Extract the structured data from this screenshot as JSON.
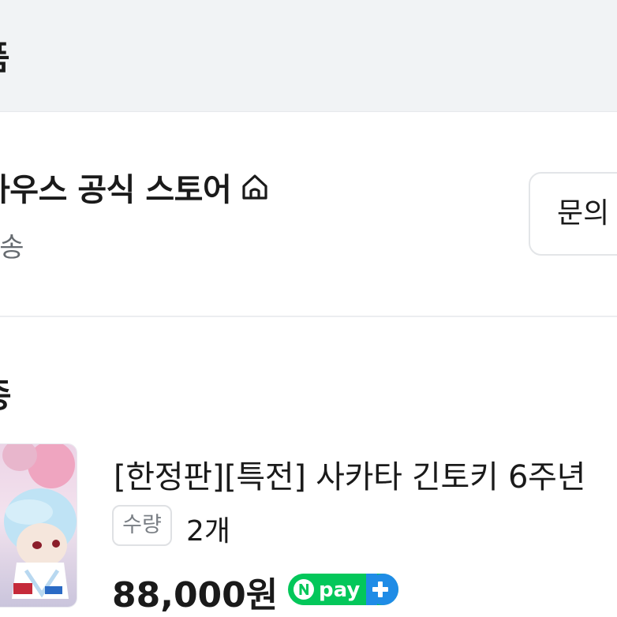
{
  "header": {
    "section_title": "품"
  },
  "store": {
    "name": "하우스 공식 스토어",
    "icon": "home-icon",
    "delivery": "배송",
    "inquiry_button": "문의"
  },
  "order": {
    "section_title": "종",
    "product": {
      "title": "[한정판][특전] 사카타 긴토키 6주년",
      "quantity_label": "수량",
      "quantity_value": "2개",
      "price": "88,000원",
      "payment_badge": "Npay+"
    }
  },
  "colors": {
    "band_background": "#f1f3f5",
    "npay_green": "#03c75a",
    "npay_blue": "#1f8ce6"
  }
}
